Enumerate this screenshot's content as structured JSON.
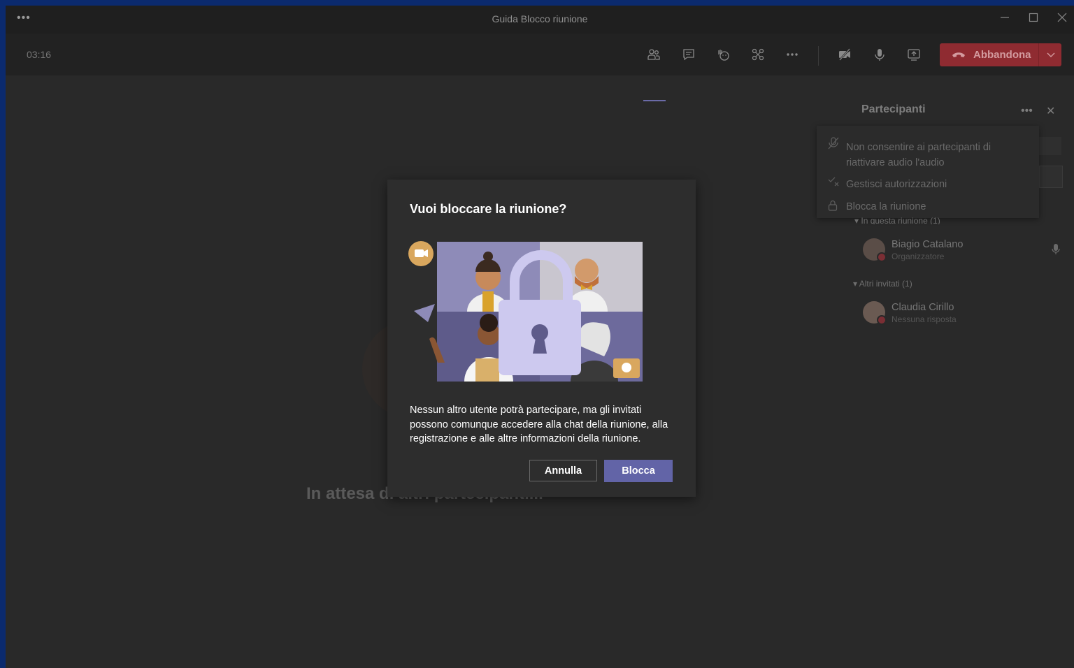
{
  "window": {
    "title": "Guida Blocco riunione",
    "menu_dots": "•••",
    "controls": [
      "minimize-icon",
      "maximize-icon",
      "close-icon"
    ]
  },
  "toolbar": {
    "timer": "03:16",
    "icons": [
      "participants-icon",
      "chat-icon",
      "raise-hand-icon",
      "breakout-rooms-icon",
      "more-icon",
      "camera-off-icon",
      "microphone-icon",
      "share-screen-icon"
    ],
    "leave_label": "Abbandona",
    "leave_color": "#8f2b31"
  },
  "stage": {
    "waiting_text": "In attesa di altri partecipanti..."
  },
  "panel": {
    "title": "Partecipanti",
    "more_glyph": "•••",
    "close_glyph": "✕",
    "menu": [
      {
        "icon": "mic-off-icon",
        "label_line1": "Non consentire ai partecipanti di",
        "label_line2": "riattivare audio l'audio"
      },
      {
        "icon": "permissions-icon",
        "label": "Gestisci autorizzazioni"
      },
      {
        "icon": "lock-icon",
        "label": "Blocca la riunione"
      }
    ],
    "section_in_meeting": "In questa riunione (1)",
    "section_others": "Altri invitati (1)",
    "people": [
      {
        "name": "Biagio Catalano",
        "role": "Organizzatore"
      },
      {
        "name": "Claudia Cirillo",
        "role": "Nessuna risposta"
      }
    ]
  },
  "dialog": {
    "title": "Vuoi bloccare la riunione?",
    "body": "Nessun altro utente potrà partecipare, ma gli invitati possono comunque accedere alla chat della riunione, alla registrazione e alle altre informazioni della riunione.",
    "cancel_label": "Annulla",
    "confirm_label": "Blocca",
    "accent": "#6264a7"
  }
}
